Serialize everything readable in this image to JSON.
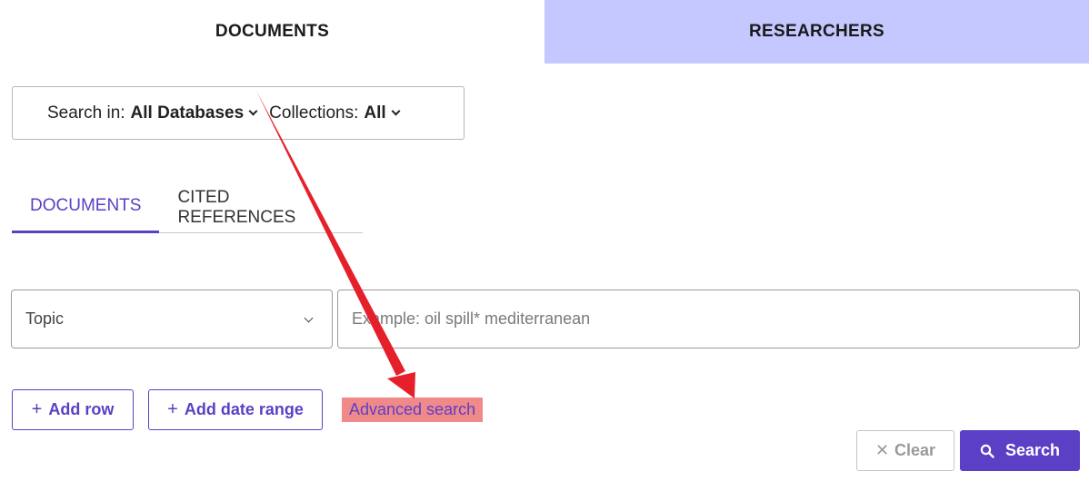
{
  "top_tabs": {
    "documents": "DOCUMENTS",
    "researchers": "RESEARCHERS"
  },
  "database_selector": {
    "search_in_label": "Search in:",
    "search_in_value": "All Databases",
    "collections_label": "Collections:",
    "collections_value": "All"
  },
  "sub_tabs": {
    "documents": "DOCUMENTS",
    "cited_references": "CITED REFERENCES"
  },
  "search_row": {
    "field": "Topic",
    "placeholder": "Example: oil spill* mediterranean"
  },
  "actions": {
    "add_row": "Add row",
    "add_date_range": "Add date range",
    "advanced_search": "Advanced search",
    "clear": "Clear",
    "search": "Search"
  },
  "colors": {
    "accent": "#5b3fc4",
    "inactive_tab": "#c5c8ff",
    "highlight": "#f08a8a",
    "annotation_arrow": "#e5202a"
  }
}
